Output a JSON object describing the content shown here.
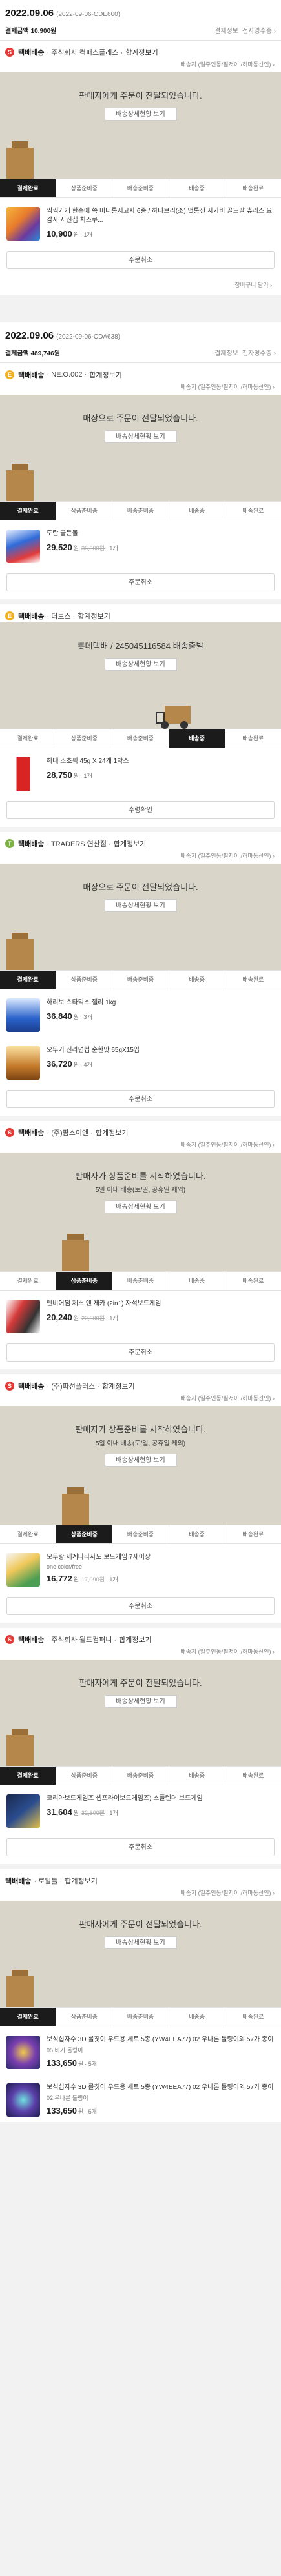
{
  "orders": [
    {
      "date": "2022.09.06",
      "order_no": "(2022-09-06-CDE600)",
      "sum_label": "결제금액 10,900원",
      "links": [
        "결제정보",
        "전자영수증 ›"
      ],
      "shipments": [
        {
          "badge": "S",
          "type": "택배배송",
          "seller": "· 주식회사 컴퍼스플래스 ·",
          "detail_link": "합계정보기",
          "addr": "배송지 (일주인동/필저이 /허마동선인) ›",
          "message": "판매자에게 주문이 전달되었습니다.",
          "tracking": "배송상세현황 보기",
          "steps": [
            "결제완료",
            "상품준비중",
            "배송준비중",
            "배송중",
            "배송완료"
          ],
          "active_step": 0,
          "items": [
            {
              "name": "씩씩가게 한손에 쏙 미니롱지고자 6종 / 하나브리(소) 멋통신 자가비 골드팔 츄러스 요감자 지진칩 치즈쿠...",
              "option": "",
              "price": "10,900",
              "unit": "원",
              "orig_price": "",
              "qty": "· 1개"
            }
          ],
          "action": "주문취소",
          "extra": "장바구니 담기 ›"
        }
      ]
    },
    {
      "date": "2022.09.06",
      "order_no": "(2022-09-06-CDA638)",
      "sum_label": "결제금액 489,746원",
      "links": [
        "결제정보",
        "전자영수증 ›"
      ],
      "shipments": [
        {
          "badge": "E",
          "type": "택배배송",
          "seller": "· NE.O.002 ·",
          "detail_link": "합계정보기",
          "addr": "배송지 (일주인동/필저이 /허마동선인) ›",
          "message": "매장으로 주문이 전달되었습니다.",
          "tracking": "배송상세현황 보기",
          "steps": [
            "결제완료",
            "상품준비중",
            "배송준비중",
            "배송중",
            "배송완료"
          ],
          "active_step": 0,
          "items": [
            {
              "name": "도란 골든볼",
              "option": "",
              "price": "29,520",
              "unit": "원",
              "orig_price": "36,000원",
              "qty": "· 1개"
            }
          ],
          "action": "주문취소"
        },
        {
          "badge": "E",
          "type": "택배배송",
          "seller": "· 더보스 ·",
          "detail_link": "합계정보기",
          "addr": "",
          "message": "롯데택배 / 245045116584 배송출발",
          "tracking": "배송상세현황 보기",
          "steps": [
            "결제완료",
            "상품준비중",
            "배송준비중",
            "배송중",
            "배송완료"
          ],
          "active_step": 3,
          "items": [
            {
              "name": "해태 조초픽 45g X 24개 1박스",
              "option": "",
              "price": "28,750",
              "unit": "원",
              "orig_price": "",
              "qty": "· 1개"
            }
          ],
          "action": "수령확인"
        },
        {
          "badge": "T",
          "type": "택배배송",
          "seller": "· TRADERS 연산점 ·",
          "detail_link": "합계정보기",
          "addr": "배송지 (일주인동/필저이 /허마동선인) ›",
          "message": "매장으로 주문이 전달되었습니다.",
          "tracking": "배송상세현황 보기",
          "steps": [
            "결제완료",
            "상품준비중",
            "배송준비중",
            "배송중",
            "배송완료"
          ],
          "active_step": 0,
          "items": [
            {
              "name": "하리보 스타믹스 젤리 1kg",
              "option": "",
              "price": "36,840",
              "unit": "원",
              "orig_price": "",
              "qty": "· 3개"
            },
            {
              "name": "오뚜기 진라면컵 순한맛 65gX15입",
              "option": "",
              "price": "36,720",
              "unit": "원",
              "orig_price": "",
              "qty": "· 4개"
            }
          ],
          "action": "주문취소"
        },
        {
          "badge": "S",
          "type": "택배배송",
          "seller": "· (주)팜스이엔 ·",
          "detail_link": "합계정보기",
          "addr": "배송지 (일주인동/필저이 /허마동선인) ›",
          "message": "판매자가 상품준비를 시작하였습니다.",
          "message2": "5일 이내 배송(토/일, 공휴일 제외)",
          "tracking": "배송상세현황 보기",
          "steps": [
            "결제완료",
            "상품준비중",
            "배송준비중",
            "배송중",
            "배송완료"
          ],
          "active_step": 1,
          "items": [
            {
              "name": "맨비어쨈 제스 앤 제카 (2in1) 자석보드게임",
              "option": "",
              "price": "20,240",
              "unit": "원",
              "orig_price": "22,000원",
              "qty": "· 1개"
            }
          ],
          "action": "주문취소"
        },
        {
          "badge": "S",
          "type": "택배배송",
          "seller": "· (주)파선플러스 ·",
          "detail_link": "합계정보기",
          "addr": "배송지 (일주인동/필저이 /허마동선인) ›",
          "message": "판매자가 상품준비를 시작하였습니다.",
          "message2": "5일 이내 배송(토/일, 공휴일 제외)",
          "tracking": "배송상세현황 보기",
          "steps": [
            "결제완료",
            "상품준비중",
            "배송준비중",
            "배송중",
            "배송완료"
          ],
          "active_step": 1,
          "items": [
            {
              "name": "모두랑 세계나라사도 보드게임 7세이상",
              "option": "one color/free",
              "price": "16,772",
              "unit": "원",
              "orig_price": "17,090원",
              "qty": "· 1개"
            }
          ],
          "action": "주문취소"
        },
        {
          "badge": "S",
          "type": "택배배송",
          "seller": "· 주식회사 월드컴퍼니 ·",
          "detail_link": "합계정보기",
          "addr": "배송지 (일주인동/필저이 /허마동선인) ›",
          "message": "판매자에게 주문이 전달되었습니다.",
          "tracking": "배송상세현황 보기",
          "steps": [
            "결제완료",
            "상품준비중",
            "배송준비중",
            "배송중",
            "배송완료"
          ],
          "active_step": 0,
          "items": [
            {
              "name": "코리아보드게임즈 셉프라이보드게임즈) 스플렌더 보드게임",
              "option": "",
              "price": "31,604",
              "unit": "원",
              "orig_price": "32,600원",
              "qty": "· 1개"
            }
          ],
          "action": "주문취소"
        },
        {
          "badge": "",
          "type": "택배배송",
          "seller": "· 로알틀 ·",
          "detail_link": "합계정보기",
          "addr": "배송지 (일주인동/필저이 /허마동선인) ›",
          "message": "판매자에게 주문이 전달되었습니다.",
          "tracking": "배송상세현황 보기",
          "steps": [
            "결제완료",
            "상품준비중",
            "배송준비중",
            "배송중",
            "배송완료"
          ],
          "active_step": 0,
          "items": [
            {
              "name": "보석십자수 3D 롤칫이 우드용 세트 5종 (YW4EEA77) 02 우나론 톨링이외 57가 종이",
              "option": "05.비기 톨링이",
              "price": "133,650",
              "unit": "원",
              "orig_price": "",
              "qty": "· 5개"
            },
            {
              "name": "보석십자수 3D 롤칫이 우드용 세트 5종 (YW4EEA77) 02 우나론 톨링이외 57가 종이",
              "option": "02.우나론 톨링이",
              "price": "133,650",
              "unit": "원",
              "orig_price": "",
              "qty": "· 5개"
            }
          ],
          "action": ""
        }
      ]
    }
  ],
  "colors": {
    "hero_bg": "#d9d5c9",
    "active_step": "#1b1b1b",
    "accent_red": "#e53935"
  }
}
